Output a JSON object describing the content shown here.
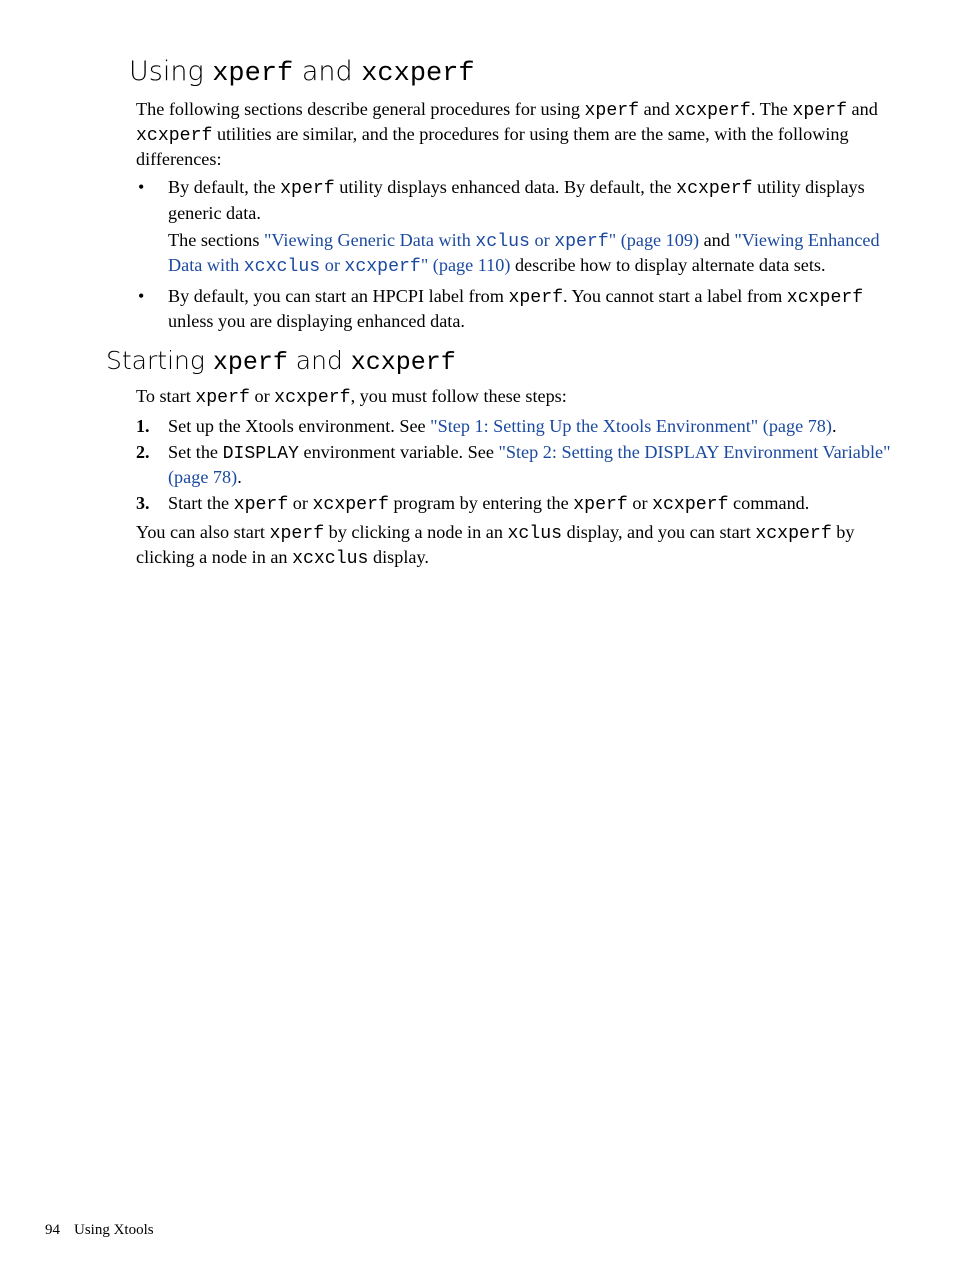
{
  "section": {
    "heading_prefix": "Using ",
    "heading_code1": "xperf",
    "heading_mid": " and ",
    "heading_code2": "xcxperf",
    "intro": {
      "t1": "The following sections describe general procedures for using ",
      "c1": "xperf",
      "t2": " and ",
      "c2": "xcxperf",
      "t3": ". The ",
      "c3": "xperf",
      "t4": " and ",
      "c4": "xcxperf",
      "t5": " utilities are similar, and the procedures for using them are the same, with the following differences:"
    },
    "bullets": [
      {
        "p1": {
          "t1": "By default, the ",
          "c1": "xperf",
          "t2": " utility displays enhanced data. By default, the ",
          "c2": "xcxperf",
          "t3": " utility displays generic data."
        },
        "p2": {
          "t1": "The sections ",
          "link1a": "\"Viewing Generic Data with ",
          "link1code1": "xclus",
          "link1mid": " or ",
          "link1code2": "xperf",
          "link1b": "\" (page 109)",
          "t2": " and ",
          "link2a": "\"Viewing Enhanced Data with ",
          "link2code1": "xcxclus",
          "link2mid": " or ",
          "link2code2": "xcxperf",
          "link2b": "\" (page 110)",
          "t3": " describe how to display alternate data sets."
        }
      },
      {
        "p1": {
          "t1": "By default, you can start an HPCPI label from ",
          "c1": "xperf",
          "t2": ". You cannot start a label from ",
          "c2": "xcxperf",
          "t3": " unless you are displaying enhanced data."
        }
      }
    ]
  },
  "subsection": {
    "heading_prefix": "Starting ",
    "heading_code1": "xperf",
    "heading_mid": " and ",
    "heading_code2": "xcxperf",
    "intro": {
      "t1": "To start ",
      "c1": "xperf",
      "t2": " or ",
      "c2": "xcxperf",
      "t3": ", you must follow these steps:"
    },
    "steps": [
      {
        "t1": "Set up the Xtools environment. See ",
        "link": "\"Step 1: Setting Up the Xtools Environment\" (page 78)",
        "t2": "."
      },
      {
        "t1": "Set the ",
        "c1": "DISPLAY",
        "t2": " environment variable. See ",
        "link": "\"Step 2: Setting the DISPLAY Environment Variable\" (page 78)",
        "t3": "."
      },
      {
        "t1": "Start the ",
        "c1": "xperf",
        "t2": " or ",
        "c2": "xcxperf",
        "t3": " program by entering the ",
        "c3": "xperf",
        "t4": " or ",
        "c4": "xcxperf",
        "t5": " command."
      }
    ],
    "outro": {
      "t1": "You can also start ",
      "c1": "xperf",
      "t2": " by clicking a node in an ",
      "c2": "xclus",
      "t3": " display, and you can start ",
      "c3": "xcxperf",
      "t4": " by clicking a node in an ",
      "c4": "xcxclus",
      "t5": " display."
    }
  },
  "footer": {
    "page": "94",
    "title": "Using Xtools"
  }
}
